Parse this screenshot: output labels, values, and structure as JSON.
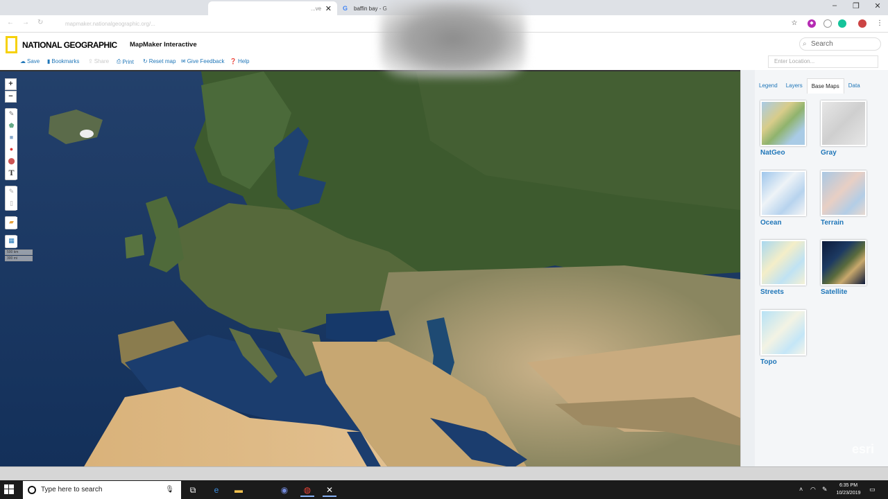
{
  "browser": {
    "tab_active_title": "...ve",
    "tab_inactive_title": "baffin bay - G",
    "url": "mapmaker.nationalgeographic.org/...",
    "window_controls": [
      "–",
      "❐",
      "✕"
    ]
  },
  "header": {
    "brand": "NATIONAL GEOGRAPHIC",
    "app_title": "MapMaker Interactive",
    "search_placeholder": "Search"
  },
  "toolbar": {
    "items": [
      {
        "label": "Save",
        "icon": "cloud-icon"
      },
      {
        "label": "Bookmarks",
        "icon": "bookmark-icon"
      },
      {
        "label": "Share",
        "icon": "share-icon"
      },
      {
        "label": "Print",
        "icon": "print-icon"
      },
      {
        "label": "Reset map",
        "icon": "refresh-icon"
      },
      {
        "label": "Give Feedback",
        "icon": "mail-icon"
      },
      {
        "label": "Help",
        "icon": "help-icon"
      }
    ],
    "location_placeholder": "Enter Location..."
  },
  "map": {
    "zoom_in": "+",
    "zoom_out": "−",
    "text_tool": "T",
    "scale": [
      "500 km",
      "300 mi"
    ]
  },
  "panel": {
    "tabs": [
      "Legend",
      "Layers",
      "Base Maps",
      "Data"
    ],
    "active_tab": "Base Maps",
    "basemaps": [
      "NatGeo",
      "Gray",
      "Ocean",
      "Terrain",
      "Streets",
      "Satellite",
      "Topo"
    ],
    "watermark": "esri"
  },
  "taskbar": {
    "search_placeholder": "Type here to search",
    "time": "6:35 PM",
    "date": "10/23/2019"
  },
  "colors": {
    "accent": "#1f76b8",
    "natgeo_yellow": "#f6d10a",
    "taskbar": "#1b1b1b"
  }
}
